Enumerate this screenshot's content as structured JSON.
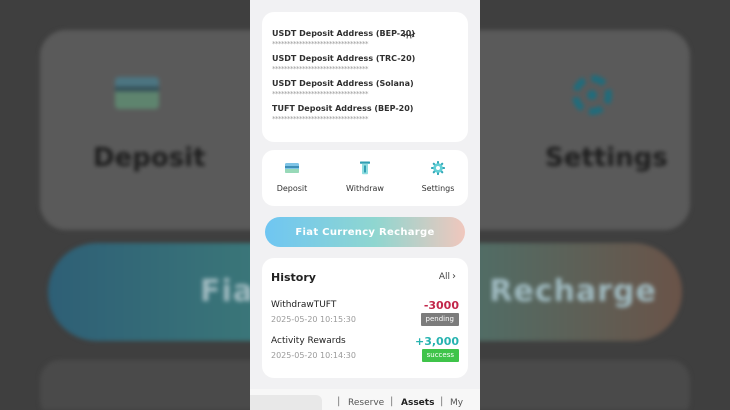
{
  "background": {
    "deposit_label": "Deposit",
    "settings_label": "Settings",
    "fiat_fragment_left": "Fiat",
    "fiat_fragment_right": "Recharge"
  },
  "addresses": [
    {
      "label": "USDT Deposit Address (BEP-20)",
      "value": "********************************"
    },
    {
      "label": "USDT Deposit Address (TRC-20)",
      "value": "********************************"
    },
    {
      "label": "USDT Deposit Address (Solana)",
      "value": "********************************"
    },
    {
      "label": "TUFT Deposit Address (BEP-20)",
      "value": "********************************"
    }
  ],
  "actions": [
    {
      "label": "Deposit",
      "icon": "card-icon"
    },
    {
      "label": "Withdraw",
      "icon": "withdraw-icon"
    },
    {
      "label": "Settings",
      "icon": "gear-icon"
    }
  ],
  "fiat_button": "Fiat Currency Recharge",
  "history": {
    "title": "History",
    "all_label": "All",
    "items": [
      {
        "name": "WithdrawTUFT",
        "time": "2025-05-20 10:15:30",
        "amount": "-3000",
        "status": "pending"
      },
      {
        "name": "Activity Rewards",
        "time": "2025-05-20 10:14:30",
        "amount": "+3,000",
        "status": "success"
      }
    ]
  },
  "bottom_nav": [
    "Reserve",
    "Assets",
    "My"
  ],
  "colors": {
    "negative": "#c2264a",
    "positive": "#27b3b0",
    "pending_badge": "#7c7c7c",
    "success_badge": "#3fc44a",
    "accent": "#6fc6f2"
  }
}
